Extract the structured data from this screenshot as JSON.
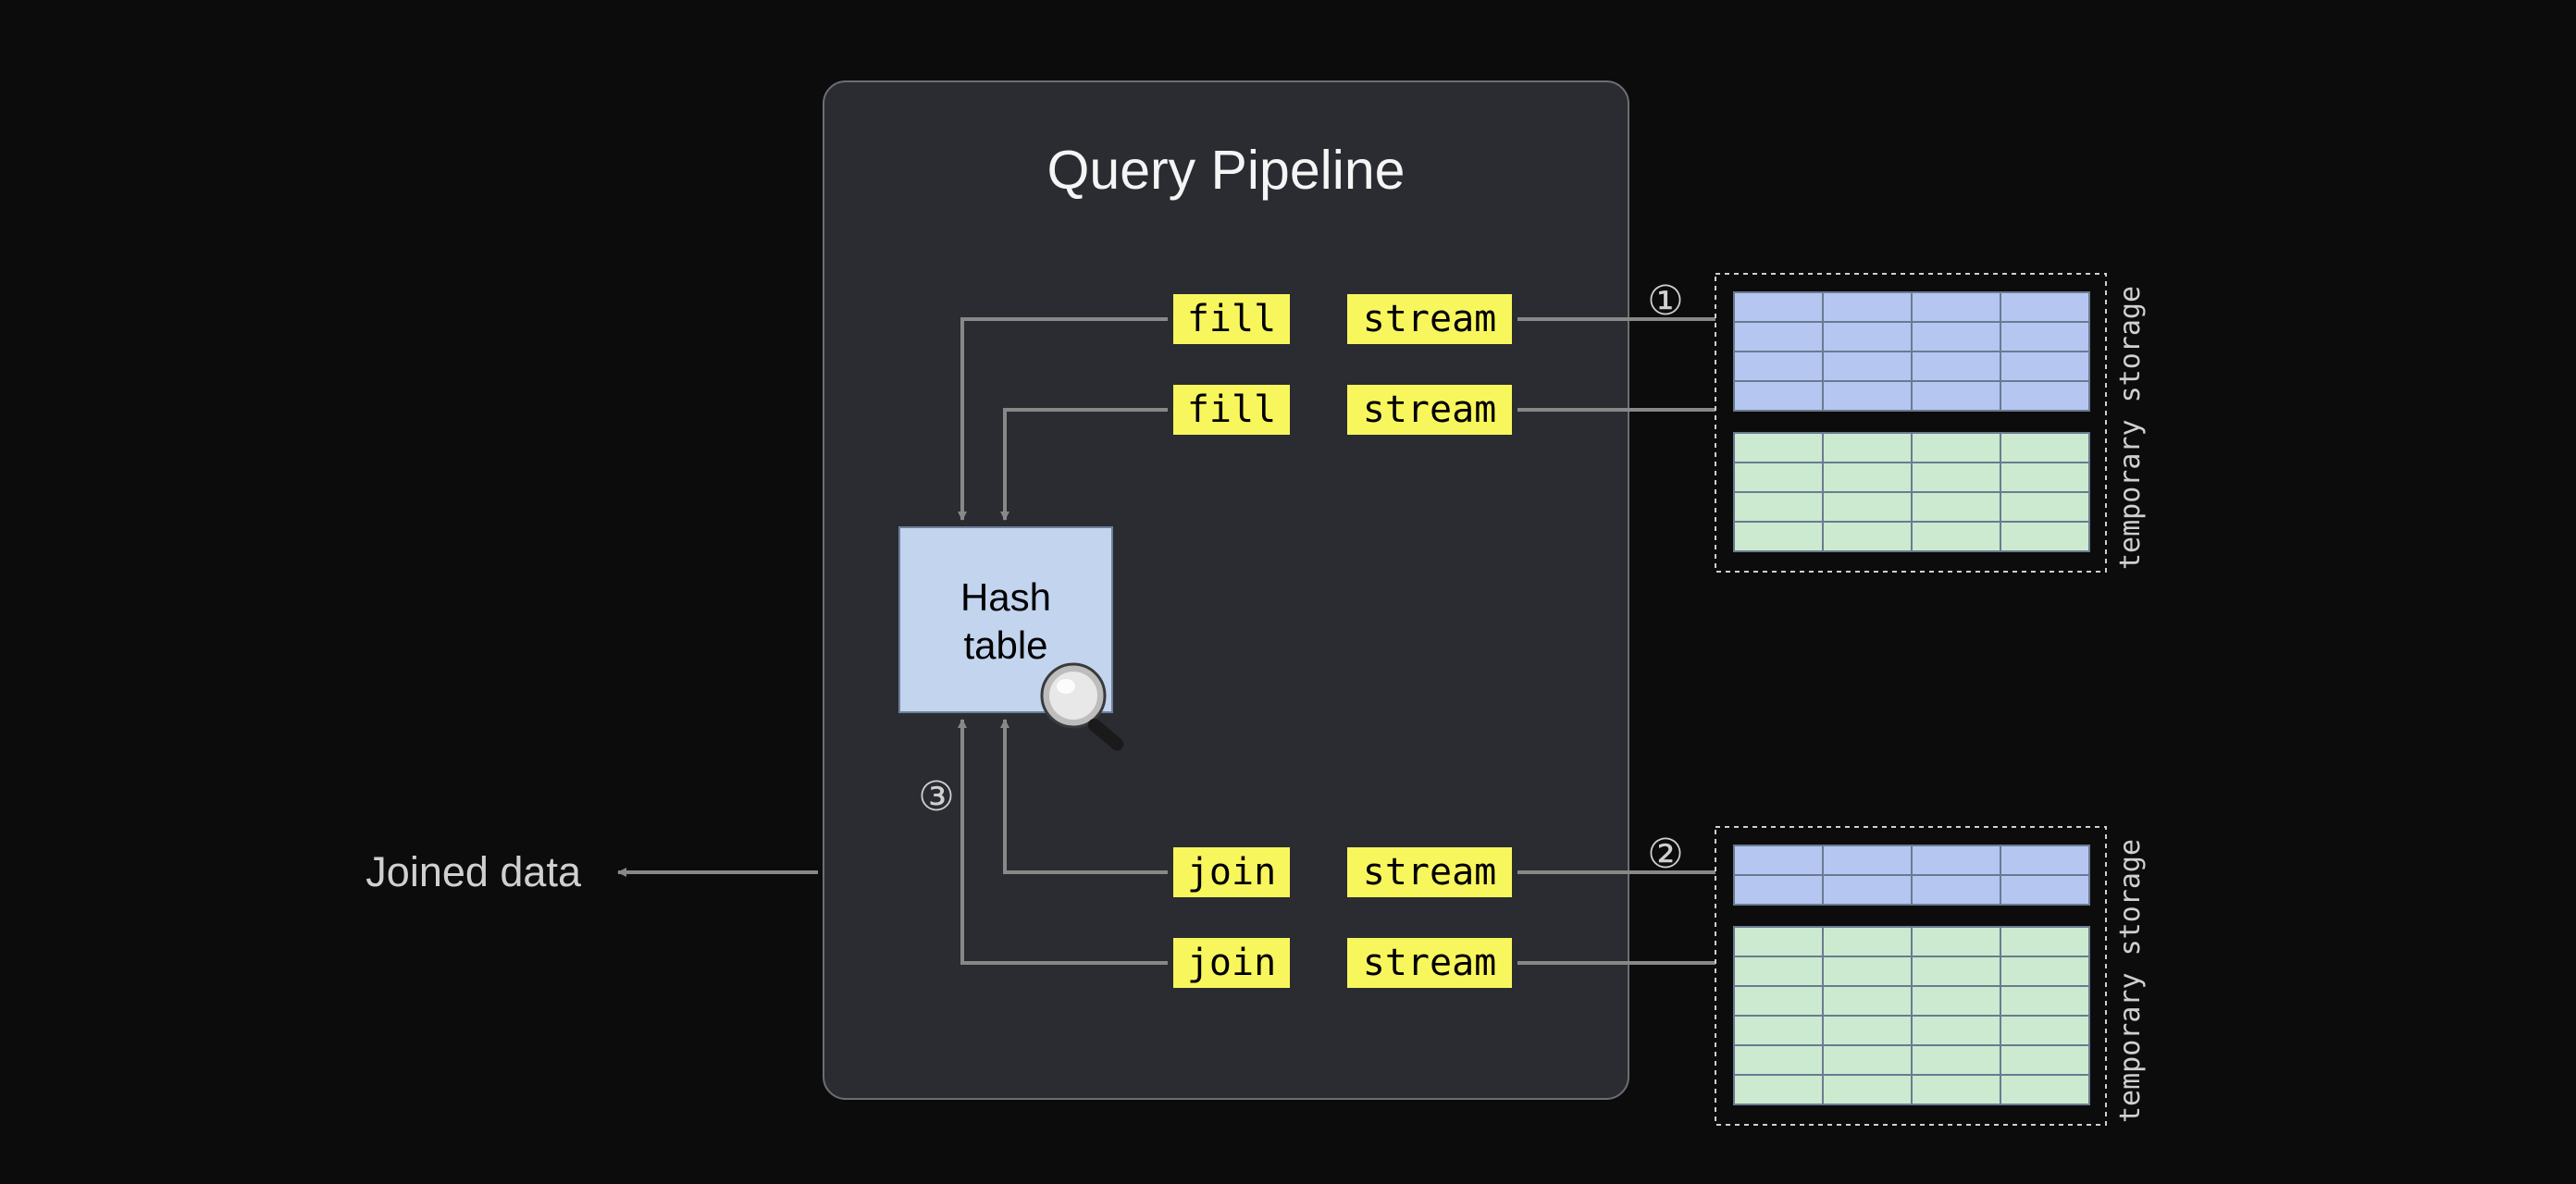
{
  "diagram": {
    "title": "Query Pipeline",
    "hash_box": {
      "line1": "Hash",
      "line2": "table"
    },
    "ops": {
      "fill1": "fill",
      "stream1": "stream",
      "fill2": "fill",
      "stream2": "stream",
      "join1": "join",
      "stream3": "stream",
      "join2": "join",
      "stream4": "stream"
    },
    "steps": {
      "one": "①",
      "two": "②",
      "three": "③"
    },
    "joined_label": "Joined data",
    "storage_label": "temporary storage",
    "colors": {
      "bg": "#0c0c0c",
      "panel": "#2a2c31",
      "panel_stroke": "#6c6e73",
      "yellow": "#f8f65d",
      "hash_fill": "#c2d4ee",
      "hash_stroke": "#6d7f99",
      "table_blue": "#b5c7f0",
      "table_green": "#cbead0",
      "table_stroke": "#6b7a91",
      "arrow": "#888888"
    },
    "storage1": {
      "blue_rows": 4,
      "green_rows": 4,
      "cols": 4
    },
    "storage2": {
      "blue_rows": 2,
      "green_rows": 6,
      "cols": 4
    }
  }
}
